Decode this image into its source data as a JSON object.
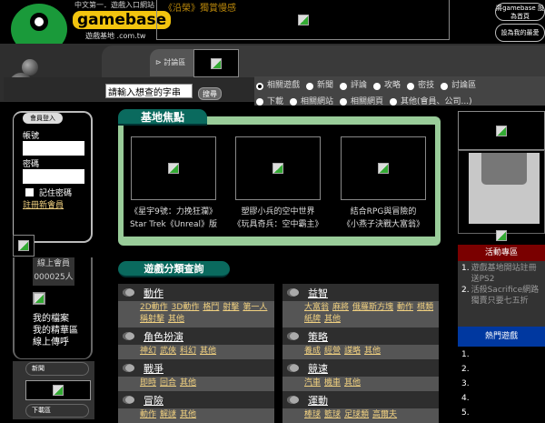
{
  "header": {
    "tagline": "中文第一．遊戲入口網站",
    "brand": "gamebase",
    "brand_sub": "遊戲基地 .com.tw",
    "banner_title": "《沿榮》獨賞慢感",
    "set_home": "將gamebase 設為首頁",
    "add_favorite": "設為我的最愛"
  },
  "nav": {
    "forum_tab": "討論區"
  },
  "search": {
    "placeholder": "請輸入想查的字串",
    "value": "請輸入想查的字串",
    "button": "搜尋",
    "options": [
      {
        "label": "相關遊戲",
        "selected": true
      },
      {
        "label": "新聞"
      },
      {
        "label": "評論"
      },
      {
        "label": "攻略"
      },
      {
        "label": "密技"
      },
      {
        "label": "討論區"
      },
      {
        "label": "下載"
      },
      {
        "label": "相關網站"
      },
      {
        "label": "相關網頁"
      },
      {
        "label": "其他(會員、公司...)"
      }
    ]
  },
  "login": {
    "title": "會員登入",
    "account": "帳號",
    "password": "密碼",
    "remember": "記住密碼",
    "register": "註冊新會員"
  },
  "online": {
    "label": "線上會員",
    "count": "000025人"
  },
  "member_links": [
    "我的檔案",
    "我的精華區",
    "線上傳呼"
  ],
  "left_pills": {
    "news": "新聞",
    "download": "下載區"
  },
  "focus": {
    "title": "基地焦點",
    "items": [
      {
        "line1": "《星宇9號：力挽狂瀾》",
        "line2": "Star Trek《Unreal》版"
      },
      {
        "line1": "塑膠小兵的空中世界",
        "line2": "《玩具奇兵：空中霸主》"
      },
      {
        "line1": "結合RPG與冒險的",
        "line2": "《小燕子決戰大富翁》"
      }
    ]
  },
  "categories": {
    "title": "遊戲分類查詢",
    "left": [
      {
        "name": "動作",
        "subs": [
          "2D動作",
          "3D動作",
          "格鬥",
          "射擊",
          "第一人稱射擊",
          "其他"
        ]
      },
      {
        "name": "角色扮演",
        "subs": [
          "神幻",
          "武俠",
          "科幻",
          "其他"
        ]
      },
      {
        "name": "戰爭",
        "subs": [
          "即時",
          "回合",
          "其他"
        ]
      },
      {
        "name": "冒險",
        "subs": [
          "動作",
          "解謎",
          "其他"
        ]
      }
    ],
    "right": [
      {
        "name": "益智",
        "subs": [
          "大富翁",
          "麻將",
          "俄羅斯方塊",
          "動作",
          "棋類",
          "紙牌",
          "其他"
        ]
      },
      {
        "name": "策略",
        "subs": [
          "養成",
          "經營",
          "謀略",
          "其他"
        ]
      },
      {
        "name": "競速",
        "subs": [
          "汽車",
          "機車",
          "其他"
        ]
      },
      {
        "name": "運動",
        "subs": [
          "棒球",
          "籃球",
          "足球類",
          "高爾夫"
        ]
      }
    ]
  },
  "activity": {
    "title": "活動專區",
    "items": [
      {
        "num": "1.",
        "text": "遊戲基地開站註冊送PS2"
      },
      {
        "num": "2.",
        "text": "活殺Sacrifice網路獨賣只要七五折"
      }
    ]
  },
  "hot_games": {
    "title": "熱門遊戲",
    "items": [
      "1.",
      "2.",
      "3.",
      "4.",
      "5."
    ]
  }
}
